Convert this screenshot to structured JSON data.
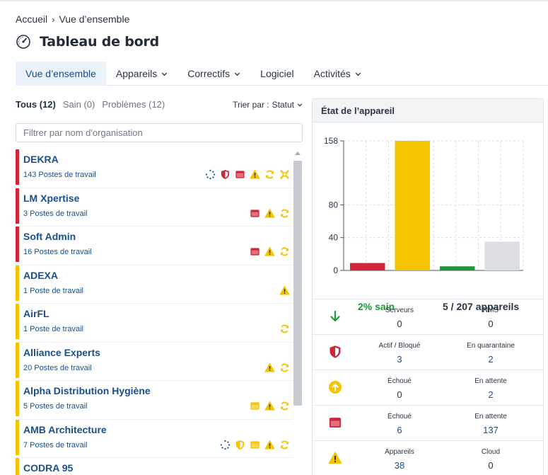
{
  "breadcrumb": {
    "home": "Accueil",
    "separator": "›",
    "current": "Vue d’ensemble"
  },
  "page": {
    "title": "Tableau de bord",
    "icon": "dashboard-gauge-icon"
  },
  "tabs": [
    {
      "label": "Vue d’ensemble",
      "active": true,
      "dropdown": false
    },
    {
      "label": "Appareils",
      "active": false,
      "dropdown": true
    },
    {
      "label": "Correctifs",
      "active": false,
      "dropdown": true
    },
    {
      "label": "Logiciel",
      "active": false,
      "dropdown": false
    },
    {
      "label": "Activités",
      "active": false,
      "dropdown": true
    }
  ],
  "filters": {
    "all": "Tous (12)",
    "healthy": "Sain (0)",
    "problems": "Problèmes (12)",
    "sort_label": "Trier par :",
    "sort_value": "Statut"
  },
  "search": {
    "placeholder": "Filtrer par nom d'organisation",
    "value": ""
  },
  "colors": {
    "red": "#d0263a",
    "yellow": "#f5c400",
    "green": "#1a9a35",
    "grey": "#dcdee2",
    "link": "#1a4f8b"
  },
  "organizations": [
    {
      "name": "DEKRA",
      "count": "143 Postes de travail",
      "status": "red",
      "icons": [
        "spinner-icon",
        "shield-icon",
        "window-icon",
        "warning-icon",
        "sync-icon",
        "x-icon"
      ]
    },
    {
      "name": "LM Xpertise",
      "count": "3 Postes de travail",
      "status": "red",
      "icons": [
        "window-icon",
        "warning-icon",
        "sync-icon"
      ]
    },
    {
      "name": "Soft Admin",
      "count": "16 Postes de travail",
      "status": "red",
      "icons": [
        "window-icon",
        "warning-icon",
        "sync-icon"
      ]
    },
    {
      "name": "ADEXA",
      "count": "1 Poste de travail",
      "status": "yellow",
      "icons": [
        "warning-icon"
      ]
    },
    {
      "name": "AirFL",
      "count": "1 Poste de travail",
      "status": "yellow",
      "icons": [
        "sync-icon"
      ]
    },
    {
      "name": "Alliance Experts",
      "count": "20 Postes de travail",
      "status": "yellow",
      "icons": [
        "warning-icon",
        "sync-icon"
      ]
    },
    {
      "name": "Alpha Distribution Hygiène",
      "count": "5 Postes de travail",
      "status": "yellow",
      "icons": [
        "window-icon",
        "warning-icon",
        "sync-icon"
      ]
    },
    {
      "name": "AMB Architecture",
      "count": "7 Postes de travail",
      "status": "yellow",
      "icons": [
        "spinner-icon",
        "shield-icon",
        "window-icon",
        "warning-icon",
        "sync-icon"
      ]
    },
    {
      "name": "CODRA 95",
      "count": "",
      "status": "yellow",
      "icons": []
    }
  ],
  "panel": {
    "title": "État de l’appareil",
    "healthy_caption": "2% sain",
    "devices_caption": "5 / 207 appareils",
    "rows": [
      {
        "icon": "arrow-down-icon",
        "a_label": "Serveurs",
        "a_value": "0",
        "a_link": false,
        "b_label": "NMS",
        "b_value": "0",
        "b_link": false
      },
      {
        "icon": "shield-icon",
        "a_label": "Actif / Bloqué",
        "a_value": "3",
        "a_link": true,
        "b_label": "En quarantaine",
        "b_value": "2",
        "b_link": true
      },
      {
        "icon": "arrow-up-circle-icon",
        "a_label": "Échoué",
        "a_value": "0",
        "a_link": false,
        "b_label": "En attente",
        "b_value": "2",
        "b_link": true
      },
      {
        "icon": "window-icon",
        "a_label": "Échoué",
        "a_value": "6",
        "a_link": true,
        "b_label": "En attente",
        "b_value": "137",
        "b_link": true
      },
      {
        "icon": "warning-icon",
        "a_label": "Appareils",
        "a_value": "38",
        "a_link": true,
        "b_label": "Cloud",
        "b_value": "0",
        "b_link": false
      }
    ]
  },
  "chart_data": {
    "type": "bar",
    "categories": [
      "red",
      "yellow",
      "green",
      "grey"
    ],
    "values": [
      9,
      158,
      5,
      35
    ],
    "colors": [
      "#d0263a",
      "#f5c400",
      "#1a9a35",
      "#dcdee2"
    ],
    "yticks": [
      0,
      40,
      80,
      158
    ],
    "ylim": [
      0,
      158
    ],
    "grid": true,
    "title": "",
    "xlabel": "",
    "ylabel": ""
  }
}
